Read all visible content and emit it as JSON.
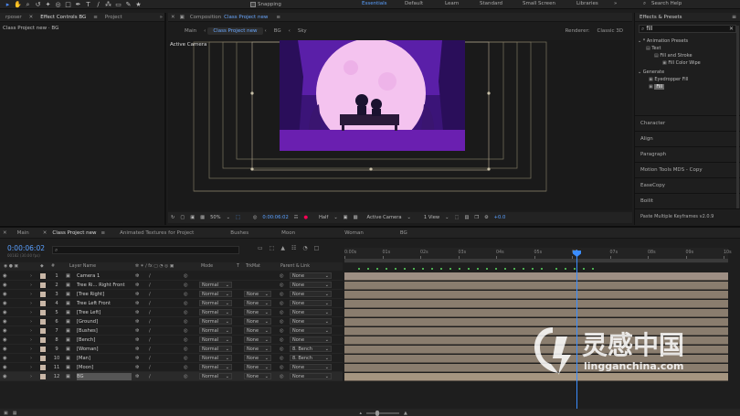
{
  "toolbar": {
    "snapping_label": "Snapping",
    "workspaces": [
      "Essentials",
      "Default",
      "Learn",
      "Standard",
      "Small Screen",
      "Libraries"
    ],
    "search_help": "Search Help"
  },
  "left_panel": {
    "tabs": [
      "rposer",
      "Effect Controls BG",
      "Project"
    ],
    "subtitle": "Class Project new · BG"
  },
  "comp": {
    "tab_label": "Composition",
    "tab_comp_name": "Class Project new",
    "crumbs": [
      "Main",
      "Class Project new",
      "BG",
      "Sky"
    ],
    "renderer_label": "Renderer:",
    "renderer_value": "Classic 3D",
    "view_label": "Active Camera",
    "footer": {
      "zoom": "50%",
      "timecode": "0:00:06:02",
      "resolution": "Half",
      "camera": "Active Camera",
      "views": "1 View",
      "exposure": "+0.0"
    }
  },
  "effects": {
    "title": "Effects & Presets",
    "search_value": "fill",
    "tree": [
      {
        "label": "* Animation Presets",
        "indent": 0
      },
      {
        "label": "Text",
        "indent": 1
      },
      {
        "label": "Fill and Stroke",
        "indent": 2
      },
      {
        "label": "Fill Color Wipe",
        "indent": 3
      },
      {
        "label": "Generate",
        "indent": 0
      },
      {
        "label": "Eyedropper Fill",
        "indent": 1
      },
      {
        "label": "Fill",
        "indent": 1
      }
    ],
    "panels": [
      "Character",
      "Align",
      "Paragraph",
      "Motion Tools MDS - Copy",
      "EaseCopy",
      "Boilit",
      "Paste Multiple Keyframes v2.0.9"
    ]
  },
  "timeline": {
    "tabs": [
      "Main",
      "Class Project new",
      "Animated Textures for Project",
      "Bushes",
      "Moon",
      "Woman",
      "BG"
    ],
    "timecode": "0:00:06:02",
    "fps": "00182 (30.00 fps)",
    "headers": {
      "num": "#",
      "name": "Layer Name",
      "mode": "Mode",
      "t": "T",
      "trkmat": "TrkMat",
      "parent": "Parent & Link"
    },
    "ruler": [
      "0:00s",
      "01s",
      "02s",
      "03s",
      "04s",
      "05s",
      "06s",
      "07s",
      "08s",
      "09s",
      "10s"
    ],
    "layers": [
      {
        "num": "1",
        "name": "Camera 1",
        "mode": "",
        "trkmat": "",
        "parent": "None"
      },
      {
        "num": "2",
        "name": "Tree Ri... Right Front",
        "mode": "Normal",
        "trkmat": "",
        "parent": "None"
      },
      {
        "num": "3",
        "name": "[Tree Right]",
        "mode": "Normal",
        "trkmat": "None",
        "parent": "None"
      },
      {
        "num": "4",
        "name": "Tree Left Front",
        "mode": "Normal",
        "trkmat": "None",
        "parent": "None"
      },
      {
        "num": "5",
        "name": "[Tree Left]",
        "mode": "Normal",
        "trkmat": "None",
        "parent": "None"
      },
      {
        "num": "6",
        "name": "[Ground]",
        "mode": "Normal",
        "trkmat": "None",
        "parent": "None"
      },
      {
        "num": "7",
        "name": "[Bushes]",
        "mode": "Normal",
        "trkmat": "None",
        "parent": "None"
      },
      {
        "num": "8",
        "name": "[Bench]",
        "mode": "Normal",
        "trkmat": "None",
        "parent": "None"
      },
      {
        "num": "9",
        "name": "[Woman]",
        "mode": "Normal",
        "trkmat": "None",
        "parent": "8. Bench"
      },
      {
        "num": "10",
        "name": "[Man]",
        "mode": "Normal",
        "trkmat": "None",
        "parent": "8. Bench"
      },
      {
        "num": "11",
        "name": "[Moon]",
        "mode": "Normal",
        "trkmat": "None",
        "parent": "None"
      },
      {
        "num": "12",
        "name": "BG",
        "mode": "Normal",
        "trkmat": "None",
        "parent": "None"
      }
    ]
  },
  "watermark": {
    "cn": "灵感中国",
    "url": "lingganchina.com"
  },
  "colors": {
    "accent": "#4c8dff",
    "timeline_bar": "#8a7d6e",
    "sky": "#5a1fa8",
    "moon": "#f4c3ef"
  }
}
